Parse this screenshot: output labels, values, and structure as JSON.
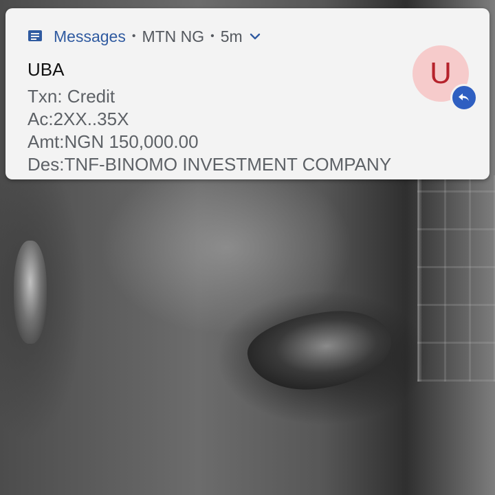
{
  "notification": {
    "app_name": "Messages",
    "app_icon": "message-icon",
    "separator": "•",
    "carrier": "MTN NG",
    "time": "5m",
    "expand_icon": "chevron-down-icon",
    "title": "UBA",
    "lines": [
      "Txn: Credit",
      "Ac:2XX..35X",
      "Amt:NGN 150,000.00",
      "Des:TNF-BINOMO INVESTMENT COMPANY"
    ],
    "avatar_letter": "U",
    "reply_icon": "reply-icon"
  },
  "colors": {
    "accent": "#2f5aa0",
    "card_bg": "#f3f3f3",
    "avatar_bg": "#f6cbcb",
    "avatar_letter": "#b6232c",
    "reply_badge": "#2f5fc1"
  }
}
